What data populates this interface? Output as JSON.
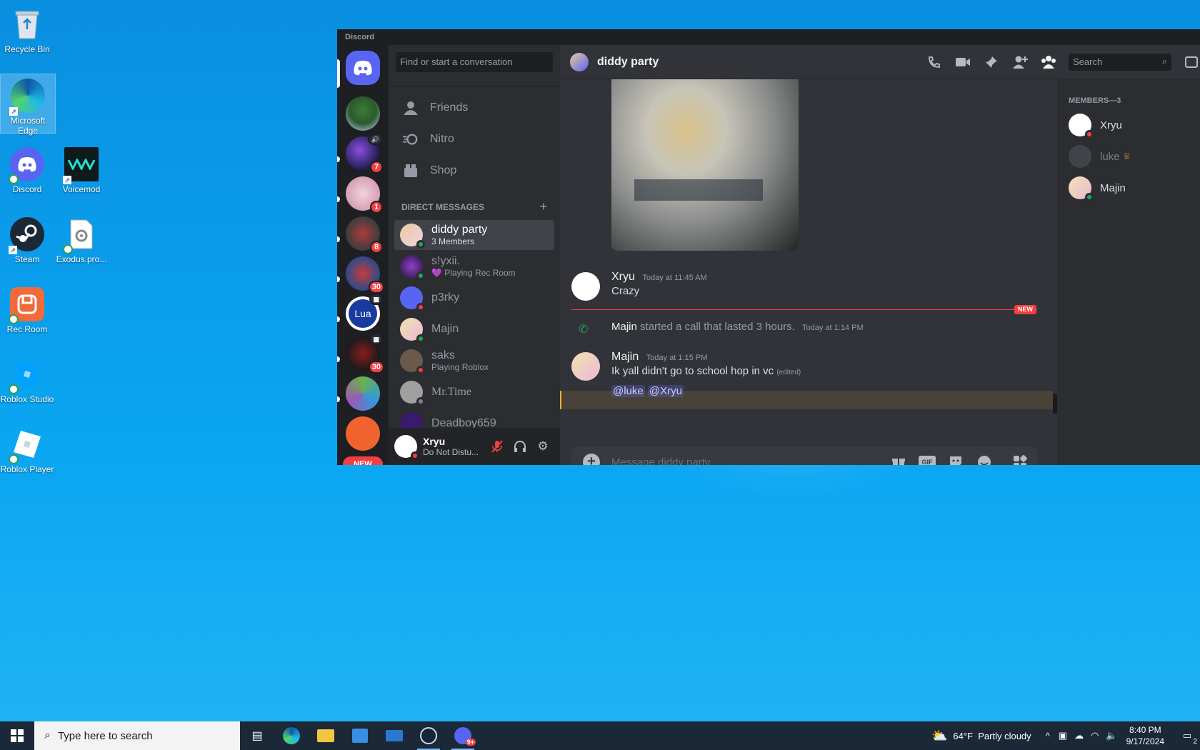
{
  "desktop": {
    "icons": [
      {
        "label": "Recycle Bin"
      },
      {
        "label": "Microsoft Edge"
      },
      {
        "label": "Discord"
      },
      {
        "label": "Voicemod"
      },
      {
        "label": "Steam"
      },
      {
        "label": "Exodus.pro..."
      },
      {
        "label": "Rec Room"
      },
      {
        "label": "Roblox Studio"
      },
      {
        "label": "Roblox Player"
      }
    ]
  },
  "window": {
    "title": "Discord"
  },
  "rail": {
    "badges": [
      "7",
      "1",
      "8",
      "30",
      "30"
    ],
    "lua_label": "Lua",
    "new_pill": "NEW"
  },
  "dm_panel": {
    "search_placeholder": "Find or start a conversation",
    "nav": [
      {
        "label": "Friends",
        "icon": "friends-icon"
      },
      {
        "label": "Nitro",
        "icon": "nitro-icon"
      },
      {
        "label": "Shop",
        "icon": "shop-icon"
      }
    ],
    "section_title": "DIRECT MESSAGES",
    "add_symbol": "+",
    "dms": [
      {
        "name": "diddy party",
        "sub": "3 Members",
        "status": "online",
        "active": true
      },
      {
        "name": "s!yxii.",
        "sub": "💜 Playing Rec Room",
        "status": "online"
      },
      {
        "name": "p3rky",
        "sub": "",
        "status": "dnd"
      },
      {
        "name": "Majin",
        "sub": "",
        "status": "online"
      },
      {
        "name": "saks",
        "sub": "Playing Roblox",
        "status": "dnd"
      },
      {
        "name": "Mr.Time",
        "sub": "",
        "status": "offline"
      },
      {
        "name": "Deadboy659",
        "sub": "",
        "status": "online"
      }
    ],
    "user": {
      "name": "Xryu",
      "status": "Do Not Distu..."
    }
  },
  "channel": {
    "name": "diddy party",
    "search_placeholder": "Search",
    "messages": {
      "xryu": {
        "author": "Xryu",
        "time": "Today at 11:45 AM",
        "text": "Crazy"
      },
      "new_label": "NEW",
      "call": {
        "author": "Majin",
        "text": "started a call that lasted 3 hours.",
        "time": "Today at 1:14 PM"
      },
      "majin": {
        "author": "Majin",
        "time": "Today at 1:15 PM",
        "text": "Ik yall didn't go to school hop in vc",
        "edited": "(edited)",
        "mentions": [
          "@luke",
          "@Xryu"
        ]
      }
    },
    "composer_placeholder": "Message diddy party",
    "gif_label": "GIF"
  },
  "members": {
    "title": "MEMBERS—3",
    "list": [
      {
        "name": "Xryu",
        "status": "dnd"
      },
      {
        "name": "luke",
        "status": "offline",
        "crown": "♛"
      },
      {
        "name": "Majin",
        "status": "online"
      }
    ]
  },
  "taskbar": {
    "search_placeholder": "Type here to search",
    "weather": "64°F  Partly cloudy",
    "time": "8:40 PM",
    "date": "9/17/2024",
    "notif_count": "2",
    "discord_badge": "9+"
  }
}
